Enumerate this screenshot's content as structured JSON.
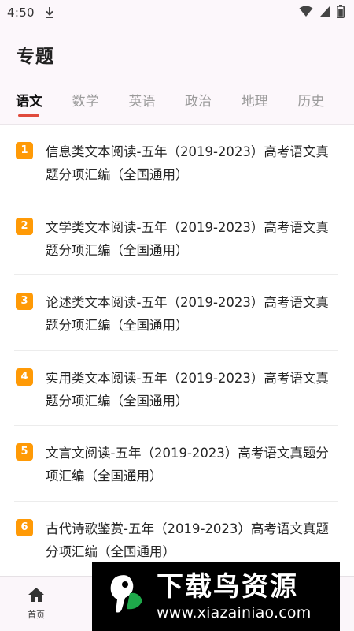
{
  "status_bar": {
    "time": "4:50"
  },
  "header": {
    "title": "专题"
  },
  "tabs": [
    {
      "label": "语文",
      "active": true
    },
    {
      "label": "数学"
    },
    {
      "label": "英语"
    },
    {
      "label": "政治"
    },
    {
      "label": "地理"
    },
    {
      "label": "历史"
    }
  ],
  "items": [
    {
      "rank": "1",
      "title": "信息类文本阅读-五年（2019-2023）高考语文真题分项汇编（全国通用）"
    },
    {
      "rank": "2",
      "title": "文学类文本阅读-五年（2019-2023）高考语文真题分项汇编（全国通用）"
    },
    {
      "rank": "3",
      "title": "论述类文本阅读-五年（2019-2023）高考语文真题分项汇编（全国通用）"
    },
    {
      "rank": "4",
      "title": "实用类文本阅读-五年（2019-2023）高考语文真题分项汇编（全国通用）"
    },
    {
      "rank": "5",
      "title": "文言文阅读-五年（2019-2023）高考语文真题分项汇编（全国通用）"
    },
    {
      "rank": "6",
      "title": "古代诗歌鉴赏-五年（2019-2023）高考语文真题分项汇编（全国通用）"
    }
  ],
  "bottom_nav": {
    "home_label": "首页",
    "home_icon": "home-icon"
  },
  "watermark": {
    "title": "下载鸟资源",
    "url": "www.xiazainiao.com"
  },
  "colors": {
    "badge": "#ff9a06",
    "tab_indicator": "#e04a3c"
  }
}
